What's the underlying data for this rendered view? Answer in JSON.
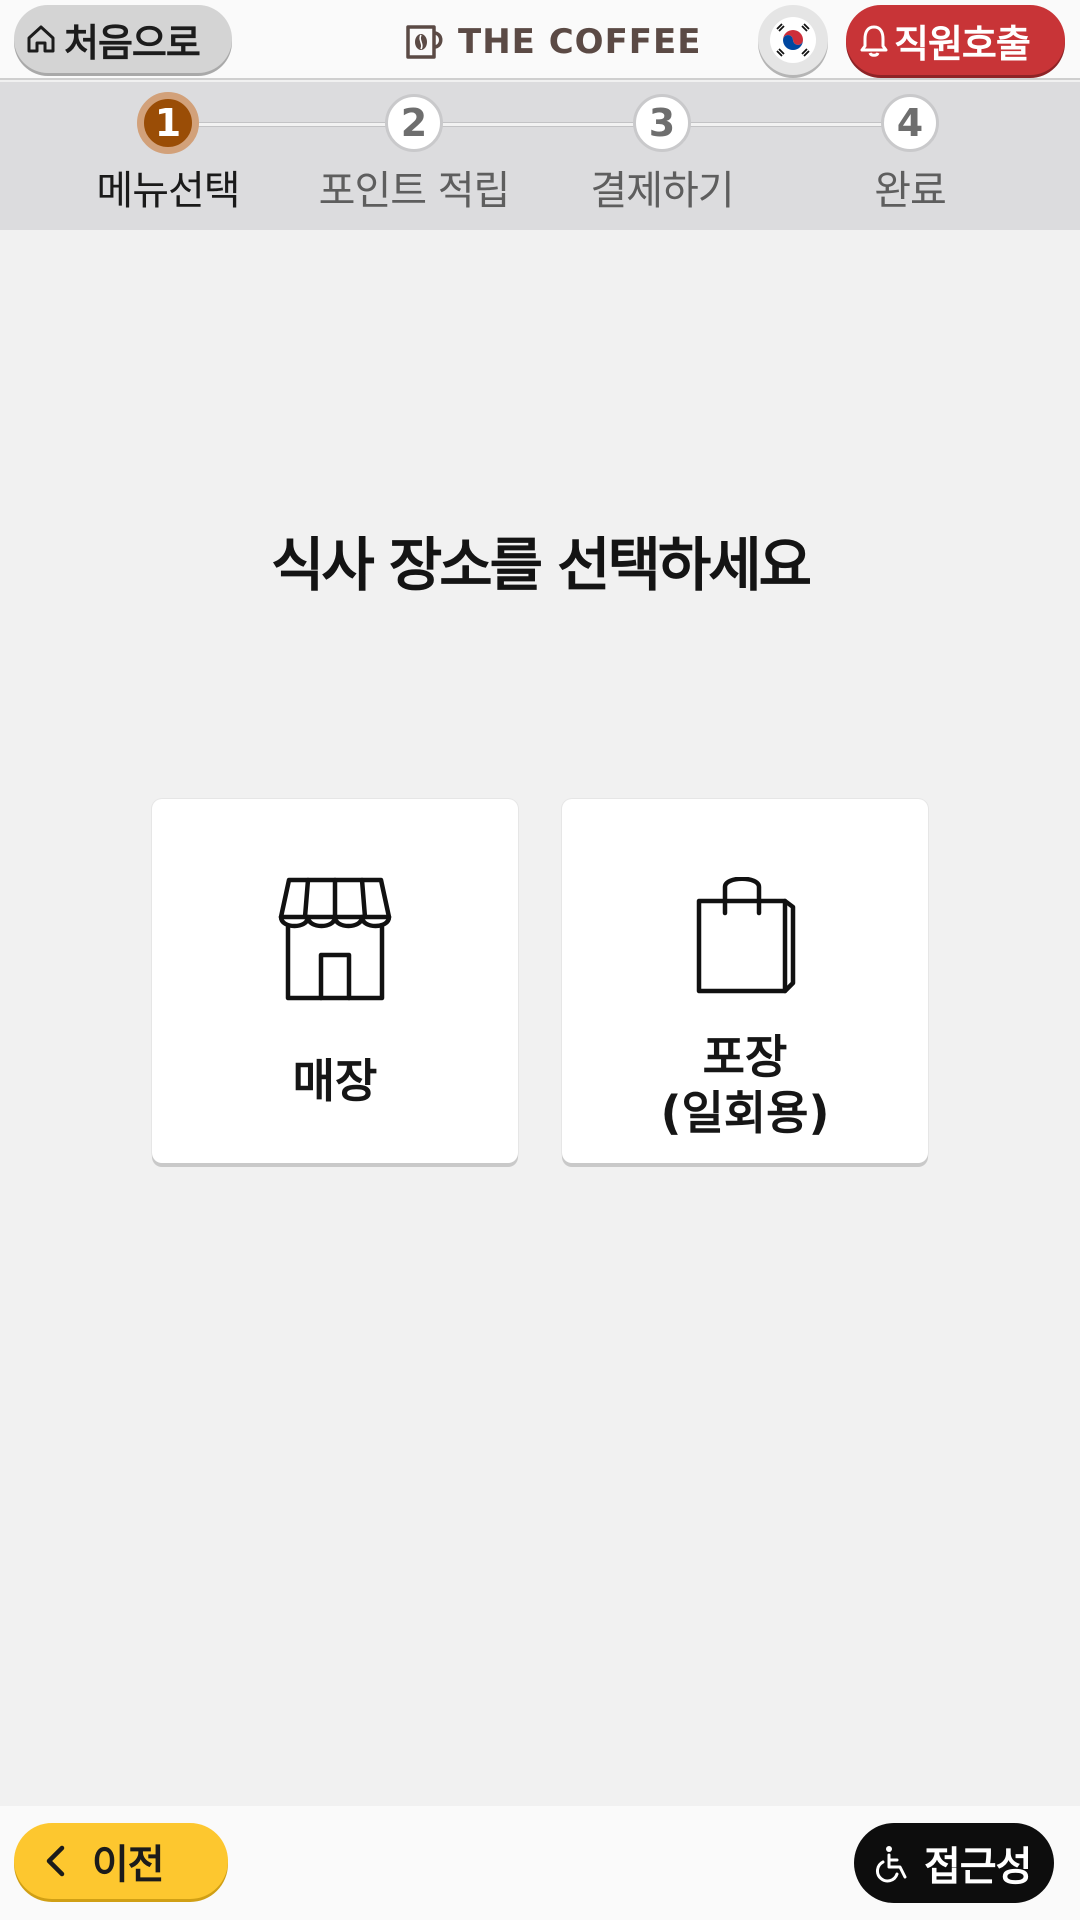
{
  "header": {
    "home_label": "처음으로",
    "brand": "THE COFFEE",
    "call_staff_label": "직원호출",
    "language_icon": "korea-flag-icon"
  },
  "steps": [
    {
      "number": "1",
      "label": "메뉴선택",
      "active": true
    },
    {
      "number": "2",
      "label": "포인트 적립",
      "active": false
    },
    {
      "number": "3",
      "label": "결제하기",
      "active": false
    },
    {
      "number": "4",
      "label": "완료",
      "active": false
    }
  ],
  "main": {
    "title": "식사 장소를 선택하세요",
    "options": [
      {
        "label": "매장",
        "icon": "store-icon"
      },
      {
        "label_line1": "포장",
        "label_line2": "(일회용)",
        "icon": "shopping-bag-icon"
      }
    ]
  },
  "footer": {
    "prev_label": "이전",
    "accessibility_label": "접근성"
  },
  "colors": {
    "accent_step": "#9a4d06",
    "call_button": "#c83437",
    "prev_button": "#fdc72f",
    "accessibility_button": "#0d0d0d",
    "brand_text": "#5b4a45"
  }
}
